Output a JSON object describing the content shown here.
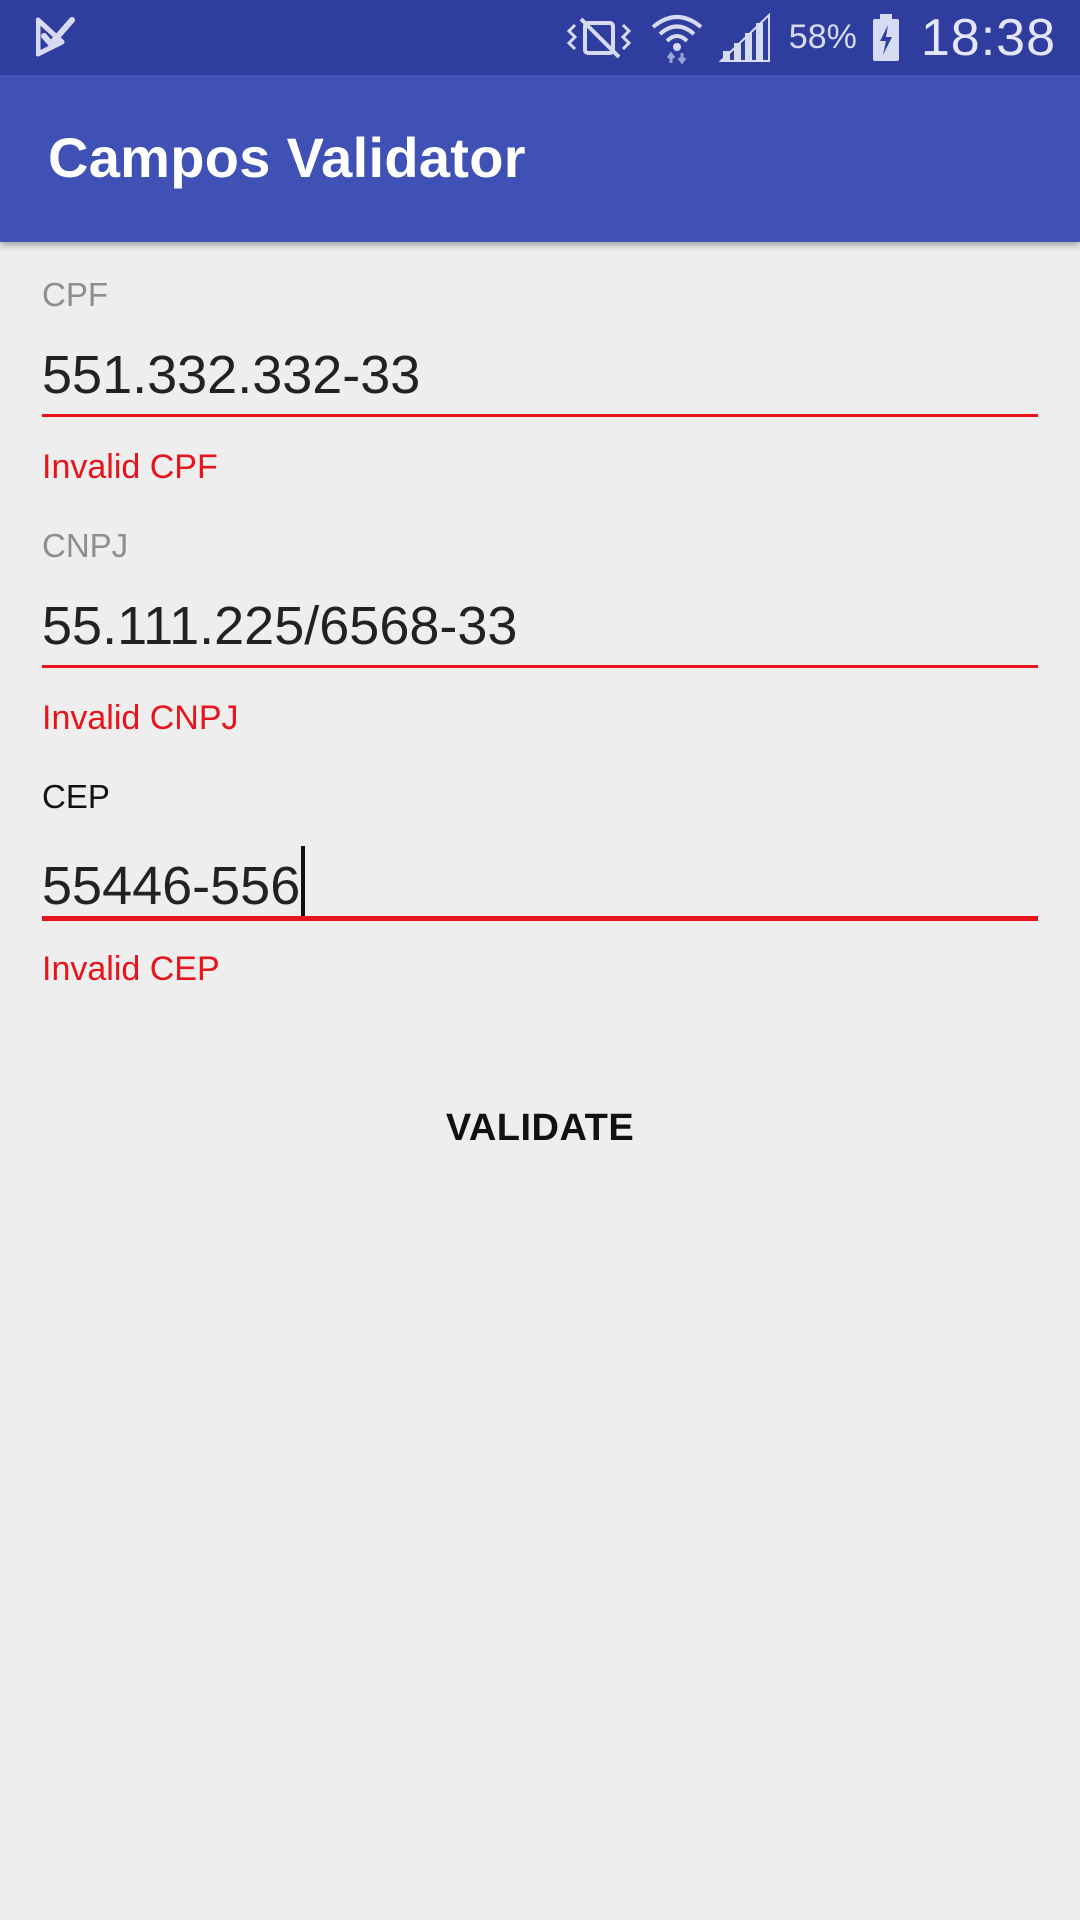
{
  "status_bar": {
    "battery_percent": "58%",
    "time": "18:38",
    "icons": [
      "check-notification-icon",
      "vibrate-mute-icon",
      "wifi-icon",
      "signal-icon",
      "battery-charging-icon"
    ]
  },
  "app_bar": {
    "title": "Campos Validator"
  },
  "form": {
    "cpf": {
      "label": "CPF",
      "value": "551.332.332-33",
      "error": "Invalid CPF"
    },
    "cnpj": {
      "label": "CNPJ",
      "value": "55.111.225/6568-33",
      "error": "Invalid CNPJ"
    },
    "cep": {
      "label": "CEP",
      "value": "55446-556",
      "error": "Invalid CEP"
    },
    "validate_label": "VALIDATE"
  },
  "colors": {
    "status_bar": "#2f3e9e",
    "app_bar": "#3f51b5",
    "error": "#e8141b",
    "background": "#eeeeee"
  }
}
